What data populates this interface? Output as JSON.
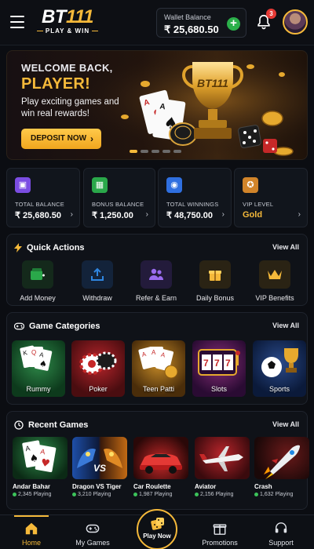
{
  "header": {
    "logo_main_prefix": "BT",
    "logo_main_suffix": "111",
    "logo_sub": "PLAY & WIN",
    "wallet_label": "Wallet Balance",
    "wallet_value": "₹ 25,680.50",
    "wallet_add": "+",
    "notification_count": "3"
  },
  "hero": {
    "line1": "WELCOME BACK,",
    "line2": "PLAYER!",
    "line3": "Play exciting games and win real rewards!",
    "button": "DEPOSIT NOW",
    "trophy_text": "BT111",
    "slide_count": 5,
    "active_slide": 0
  },
  "stats": [
    {
      "label": "TOTAL BALANCE",
      "value": "₹ 25,680.50",
      "icon": "wallet-icon",
      "color": "#7b4de2"
    },
    {
      "label": "BONUS BALANCE",
      "value": "₹ 1,250.00",
      "icon": "gift-icon",
      "color": "#2aa84a"
    },
    {
      "label": "TOTAL WINNINGS",
      "value": "₹ 48,750.00",
      "icon": "coins-icon",
      "color": "#2f6fe0"
    },
    {
      "label": "VIP LEVEL",
      "value": "Gold",
      "icon": "vip-icon",
      "color": "#d1842a"
    }
  ],
  "quick_actions": {
    "title": "Quick Actions",
    "view_all": "View All",
    "items": [
      {
        "label": "Add Money",
        "icon": "add-money-icon",
        "color": "#2aa84a"
      },
      {
        "label": "Withdraw",
        "icon": "withdraw-icon",
        "color": "#2f86e0"
      },
      {
        "label": "Refer & Earn",
        "icon": "refer-icon",
        "color": "#8a5ae6"
      },
      {
        "label": "Daily Bonus",
        "icon": "daily-bonus-icon",
        "color": "#f5b93a"
      },
      {
        "label": "VIP Benefits",
        "icon": "crown-icon",
        "color": "#f5b93a"
      }
    ]
  },
  "categories": {
    "title": "Game Categories",
    "view_all": "View All",
    "items": [
      {
        "label": "Rummy"
      },
      {
        "label": "Poker"
      },
      {
        "label": "Teen Patti"
      },
      {
        "label": "Slots"
      },
      {
        "label": "Sports"
      }
    ]
  },
  "recent": {
    "title": "Recent Games",
    "view_all": "View All",
    "items": [
      {
        "title": "Andar Bahar",
        "players": "2,345 Playing"
      },
      {
        "title": "Dragon VS Tiger",
        "players": "3,210 Playing"
      },
      {
        "title": "Car Roulette",
        "players": "1,987 Playing"
      },
      {
        "title": "Aviator",
        "players": "2,156 Playing"
      },
      {
        "title": "Crash",
        "players": "1,632 Playing"
      }
    ]
  },
  "nav": {
    "home": "Home",
    "my_games": "My Games",
    "play_now": "Play Now",
    "promotions": "Promotions",
    "support": "Support"
  },
  "colors": {
    "accent": "#f5b93a",
    "background": "#0b0d12",
    "success": "#2bb04a",
    "danger": "#e53935"
  }
}
